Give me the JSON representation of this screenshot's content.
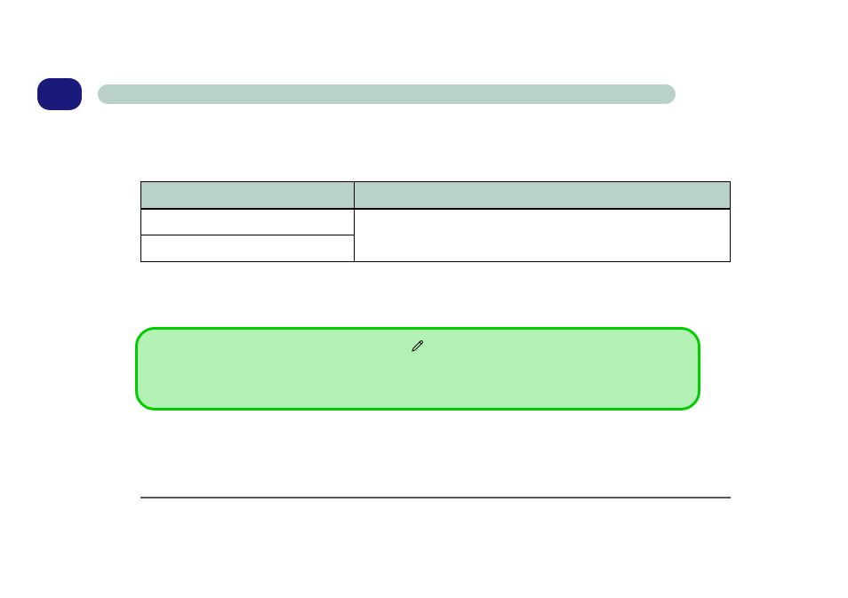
{
  "header": {
    "badge_label": "",
    "title": ""
  },
  "table": {
    "headers": [
      "",
      ""
    ],
    "rows": [
      {
        "left": "",
        "right": ""
      },
      {
        "left": ""
      }
    ]
  },
  "note": {
    "icon": "pen-icon",
    "text": ""
  }
}
